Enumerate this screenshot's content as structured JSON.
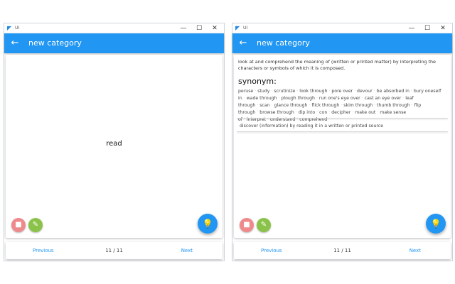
{
  "window": {
    "app_label": "UI",
    "minimize_glyph": "—",
    "maximize_glyph": "☐",
    "close_glyph": "✕"
  },
  "app_bar": {
    "title": "new category",
    "back_icon": "arrow-left-icon"
  },
  "card_front": {
    "word": "read"
  },
  "card_back": {
    "definition": "look at and comprehend the meaning of (written or printed matter) by interpreting the characters or symbols of which it is composed.",
    "synonym_heading": "synonym:",
    "synonyms": [
      "peruse",
      "study",
      "scrutinize",
      "look through",
      "pore over",
      "devour",
      "be absorbed in",
      "bury oneself in",
      "wade through",
      "plough through",
      "run one's eye over",
      "cast an eye over",
      "leaf through",
      "scan",
      "glance through",
      "flick through",
      "skim through",
      "thumb through",
      "flip through",
      "browse through",
      "dip into",
      "con",
      "decipher",
      "make out",
      "make sense of",
      "interpret",
      "understand",
      "comprehend"
    ],
    "definition_2": "discover (information) by reading it in a written or printed source"
  },
  "actions": {
    "delete_icon": "trash-icon",
    "edit_icon": "pencil-icon",
    "hint_icon": "lightbulb-icon"
  },
  "footer": {
    "previous": "Previous",
    "counter": "11 / 11",
    "next": "Next"
  },
  "colors": {
    "primary": "#2196f3",
    "delete": "#ef8a8c",
    "edit": "#8bc34a"
  }
}
